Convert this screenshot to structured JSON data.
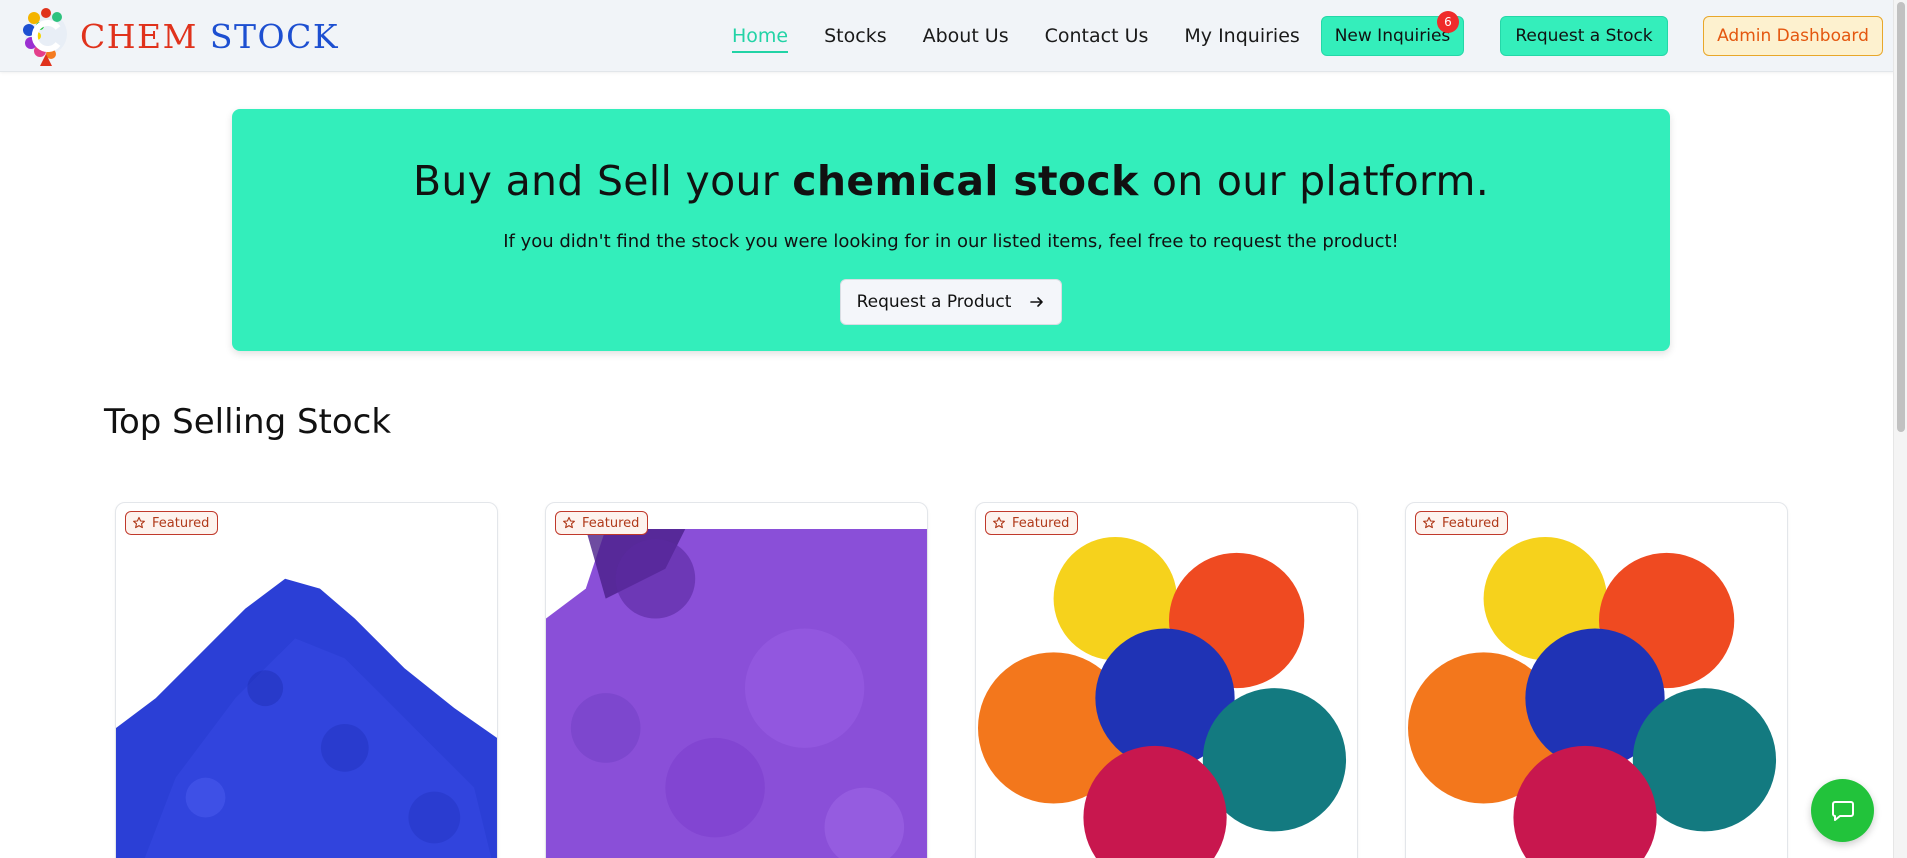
{
  "navbar": {
    "brand": {
      "word1": "CHEM",
      "word2": "STOCK"
    },
    "links": [
      {
        "label": "Home",
        "active": true
      },
      {
        "label": "Stocks",
        "active": false
      },
      {
        "label": "About Us",
        "active": false
      },
      {
        "label": "Contact Us",
        "active": false
      },
      {
        "label": "My Inquiries",
        "active": false
      }
    ],
    "new_inquiries": {
      "label": "New Inquiries",
      "count": "6"
    },
    "request_stock_label": "Request a Stock",
    "admin_label": "Admin Dashboard"
  },
  "hero": {
    "title_pre": "Buy and Sell your",
    "title_bold": "chemical stock",
    "title_post": "on our platform.",
    "subtitle": "If you didn't find the stock you were looking for in our listed items, feel free to request the product!",
    "button_label": "Request a Product"
  },
  "section": {
    "title": "Top Selling Stock"
  },
  "products": [
    {
      "badge": "Featured",
      "image": "blue-pigment-powder"
    },
    {
      "badge": "Featured",
      "image": "purple-pigment-powder"
    },
    {
      "badge": "Featured",
      "image": "multicolor-pigment-powders"
    },
    {
      "badge": "Featured",
      "image": "multicolor-pigment-powders"
    }
  ],
  "colors": {
    "accent_mint": "#33eebb",
    "brand_red": "#e0321c",
    "brand_blue": "#1d4fd1",
    "admin_orange": "#e4570f",
    "chat_green": "#22c33b",
    "badge_red": "#ef2b2b"
  }
}
